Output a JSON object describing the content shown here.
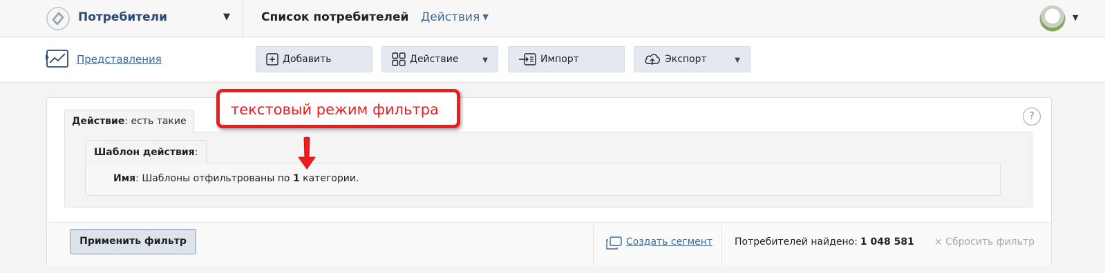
{
  "header": {
    "section_title": "Потребители",
    "page_title": "Список потребителей",
    "actions_label": "Действия"
  },
  "toolbar": {
    "views_label": "Представления",
    "buttons": {
      "add": "Добавить",
      "action": "Действие",
      "import": "Импорт",
      "export": "Экспорт"
    }
  },
  "filter": {
    "outer_tab_bold": "Действие",
    "outer_tab_rest": ": есть такие",
    "inner_tab_bold": "Шаблон действия",
    "inner_tab_rest": ":",
    "name_label": "Имя",
    "name_text_before": ": Шаблоны отфильтрованы по ",
    "name_count": "1",
    "name_text_after": " категории.",
    "help": "?"
  },
  "annotation": {
    "callout_text": "текстовый режим фильтра",
    "color": "#ee1c1c"
  },
  "footer": {
    "apply_button": "Применить фильтр",
    "create_segment": "Создать сегмент",
    "found_label": "Потребителей найдено:",
    "found_count": "1 048 581",
    "reset_label": "× Сбросить фильтр"
  },
  "colors": {
    "link": "#3e6a98",
    "title": "#2a4a72",
    "button_bg": "#e4e9ef"
  }
}
